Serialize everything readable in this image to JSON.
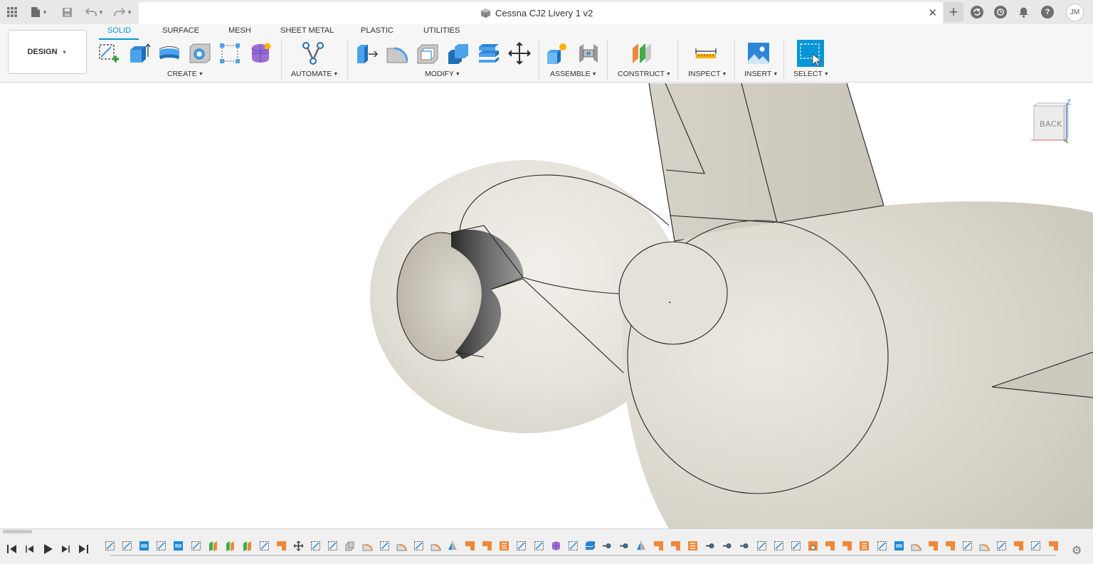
{
  "titlebar": {
    "document_title": "Cessna CJ2 Livery 1 v2",
    "close_glyph": "✕",
    "new_tab_glyph": "+",
    "avatar_initials": "JM",
    "help_glyph": "?"
  },
  "toolbar": {
    "workspace": "DESIGN",
    "tabs": [
      "SOLID",
      "SURFACE",
      "MESH",
      "SHEET METAL",
      "PLASTIC",
      "UTILITIES"
    ],
    "active_tab": "SOLID",
    "groups": {
      "create": "CREATE",
      "automate": "AUTOMATE",
      "modify": "MODIFY",
      "assemble": "ASSEMBLE",
      "construct": "CONSTRUCT",
      "inspect": "INSPECT",
      "insert": "INSERT",
      "select": "SELECT"
    }
  },
  "viewcube": {
    "face": "BACK",
    "axis": "Z"
  },
  "colors": {
    "accent": "#0696d7",
    "model_fill": "#dad6cc",
    "timeline_orange": "#f0883a",
    "timeline_blue": "#1e88d8"
  },
  "timeline": {
    "items": [
      "sk",
      "sk",
      "ex",
      "sk",
      "ex",
      "sk",
      "ls",
      "ls",
      "ls",
      "sk",
      "or",
      "mv",
      "sk",
      "sk",
      "cb",
      "fi",
      "sk",
      "fi",
      "sk",
      "fi",
      "mi",
      "or",
      "or",
      "sl",
      "sk",
      "sk",
      "fm",
      "sk",
      "sp",
      "jt",
      "jt",
      "mi",
      "or",
      "or",
      "sl",
      "jt",
      "jt",
      "jt",
      "sk",
      "sk",
      "sk",
      "fo",
      "or",
      "or",
      "sl",
      "sk",
      "ex",
      "fi",
      "or",
      "or",
      "sk",
      "fi",
      "sk",
      "or",
      "sk",
      "or"
    ]
  }
}
